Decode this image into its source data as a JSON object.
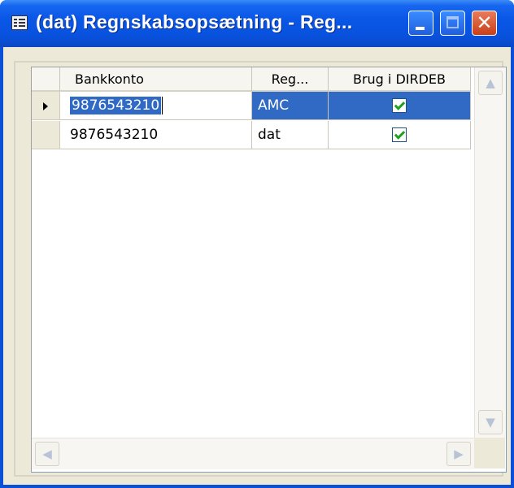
{
  "window": {
    "title": "(dat) Regnskabsopsætning - Reg...",
    "app_icon": "form-icon",
    "controls": {
      "minimize": "minimize-icon",
      "maximize": "maximize-icon",
      "close": "close-icon",
      "close_glyph": "✕"
    }
  },
  "grid": {
    "columns": [
      {
        "label": "Bankkonto"
      },
      {
        "label": "Reg..."
      },
      {
        "label": "Brug i DIRDEB"
      }
    ],
    "rows": [
      {
        "bankkonto": "9876543210",
        "reg": "AMC",
        "brug_i_dirdeb": true,
        "current": true,
        "selected": true
      },
      {
        "bankkonto": "9876543210",
        "reg": "dat",
        "brug_i_dirdeb": true,
        "current": false,
        "selected": false
      }
    ]
  },
  "scrollbars": {
    "up": "▲",
    "down": "▼",
    "left": "◀",
    "right": "▶"
  },
  "colors": {
    "titlebar": "#0a57e6",
    "selection": "#316ac5",
    "window_face": "#ece9d8",
    "close_button": "#c9401a"
  }
}
